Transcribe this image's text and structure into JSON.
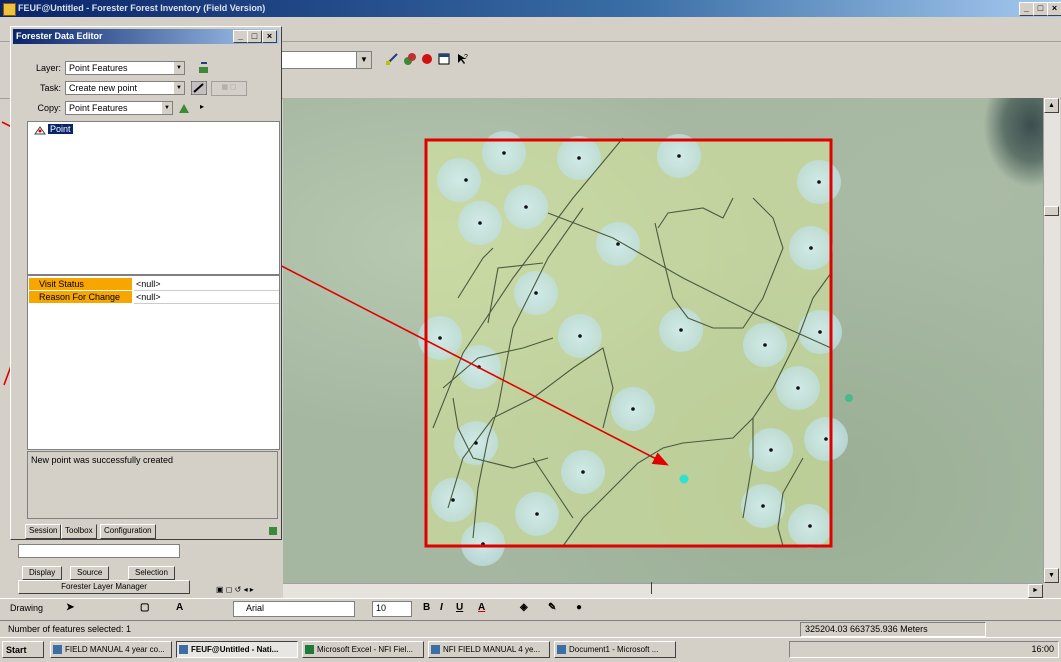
{
  "window": {
    "title": "FEUF@Untitled - Forester Forest Inventory (Field Version)",
    "controls": [
      "_",
      "□",
      "×"
    ]
  },
  "editor": {
    "title": "Forester Data Editor",
    "controls": [
      "_",
      "□",
      "×"
    ],
    "layer_label": "Layer:",
    "layer_value": "Point Features",
    "task_label": "Task:",
    "task_value": "Create new point",
    "copy_label": "Copy:",
    "copy_value": "Point Features",
    "tree_node": "Point",
    "attributes": [
      {
        "name": "Visit Status",
        "value": "<null>"
      },
      {
        "name": "Reason For Change",
        "value": "<null>"
      }
    ],
    "message": "New point was successfully created",
    "tabs": [
      "Session",
      "Toolbox",
      "Configuration"
    ]
  },
  "left_panel": {
    "tabs": [
      "Display",
      "Source",
      "Selection"
    ],
    "manager": "Forester Layer Manager"
  },
  "drawing": {
    "label": "Drawing",
    "font": "Arial",
    "size": "10",
    "bold": "B",
    "italic": "I",
    "underline": "U",
    "font_color": "A"
  },
  "status": {
    "selected": "Number of features selected: 1",
    "coords": "325204.03  663735.936 Meters"
  },
  "taskbar": {
    "start": "Start",
    "tasks": [
      "FIELD MANUAL 4 year co...",
      "FEUF@Untitled - Nati...",
      "Microsoft Excel - NFI Fiel...",
      "NFI FIELD MANUAL 4 ye...",
      "Document1 - Microsoft ..."
    ],
    "clock": "16:00"
  },
  "map": {
    "sample_plot_color": "#e00000",
    "annotation_color": "#e00000",
    "new_point_color": "#33e0d0"
  }
}
